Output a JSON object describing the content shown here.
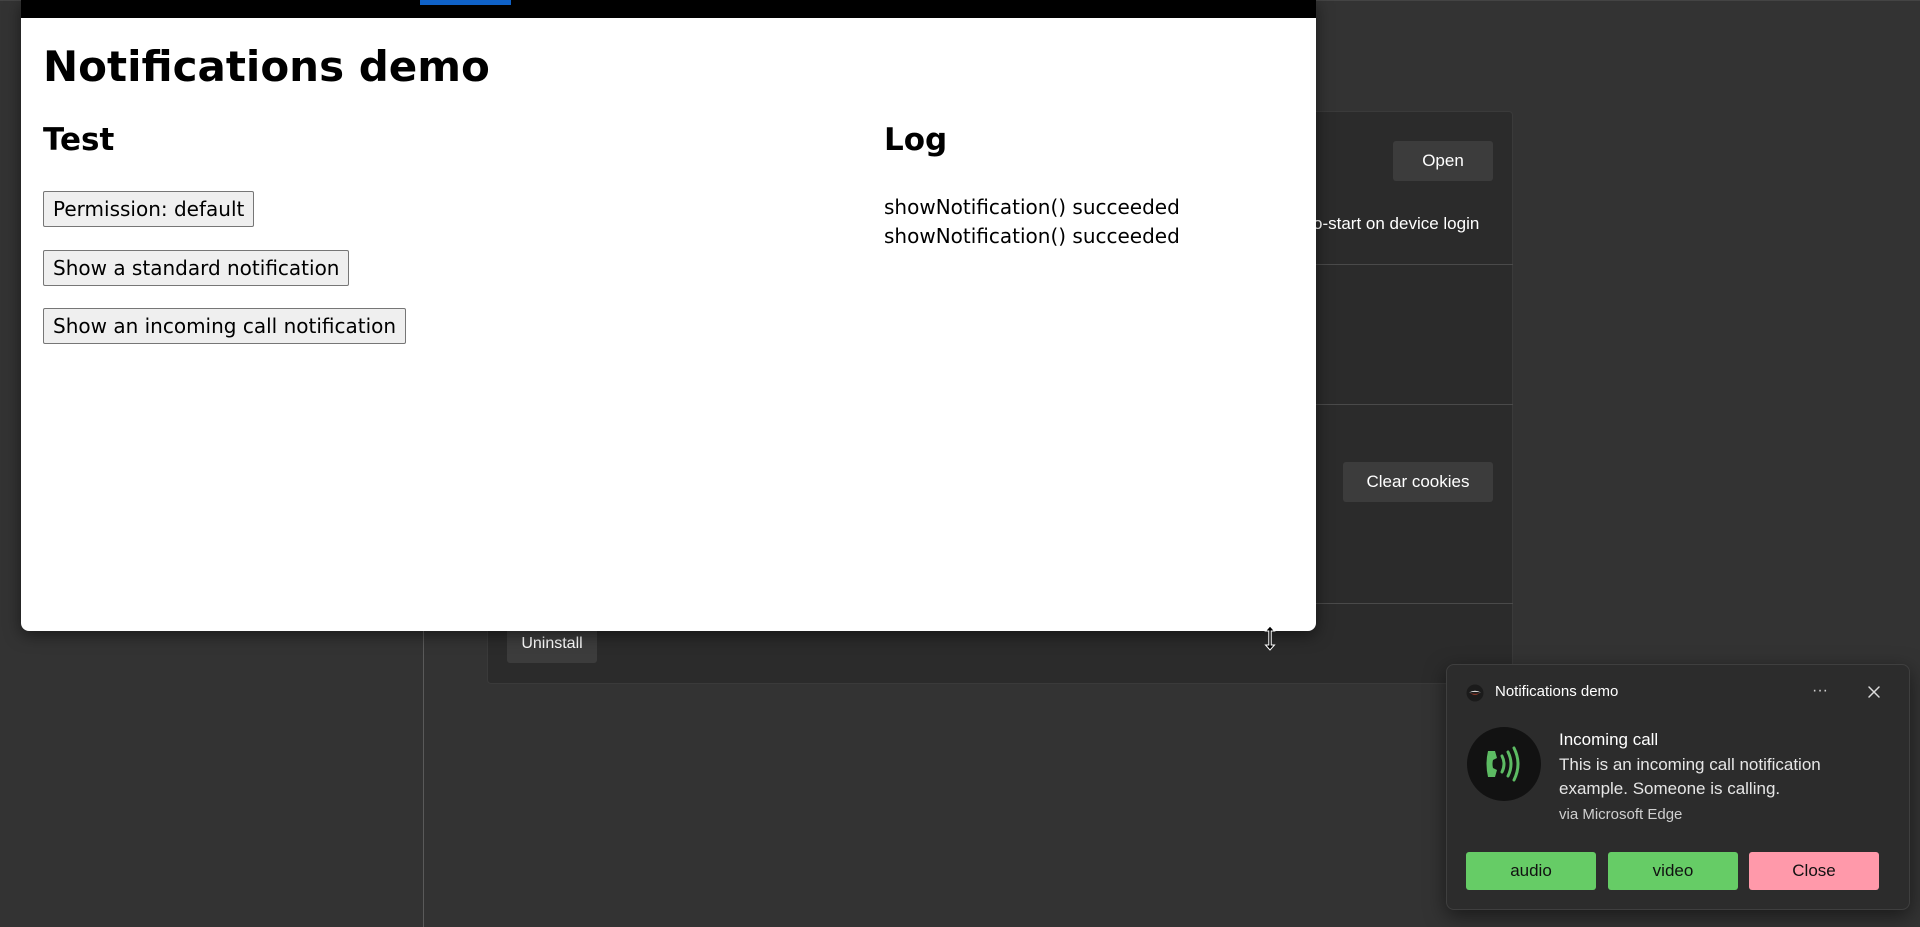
{
  "app": {
    "title": "Notifications demo",
    "test_heading": "Test",
    "log_heading": "Log",
    "buttons": {
      "permission": "Permission: default",
      "standard": "Show a standard notification",
      "incoming_call": "Show an incoming call notification"
    },
    "log": [
      "showNotification() succeeded",
      "showNotification() succeeded"
    ]
  },
  "background": {
    "open_button": "Open",
    "autostart_text": "o-start on device login",
    "clear_cookies_button": "Clear cookies",
    "uninstall_button": "Uninstall"
  },
  "toast": {
    "app_name": "Notifications demo",
    "more_label": "···",
    "title": "Incoming call",
    "body": "This is an incoming call notification example. Someone is calling.",
    "attribution": "via Microsoft Edge",
    "actions": {
      "audio": "audio",
      "video": "video",
      "close": "Close"
    },
    "colors": {
      "accept": "#66cc66",
      "decline": "#ff99aa",
      "icon_green": "#5dbb63"
    }
  },
  "icons": {
    "app": "app-logo-icon",
    "more": "more-icon",
    "close": "close-icon",
    "call": "phone-ringing-icon",
    "cursor": "resize-vertical-cursor-icon"
  }
}
